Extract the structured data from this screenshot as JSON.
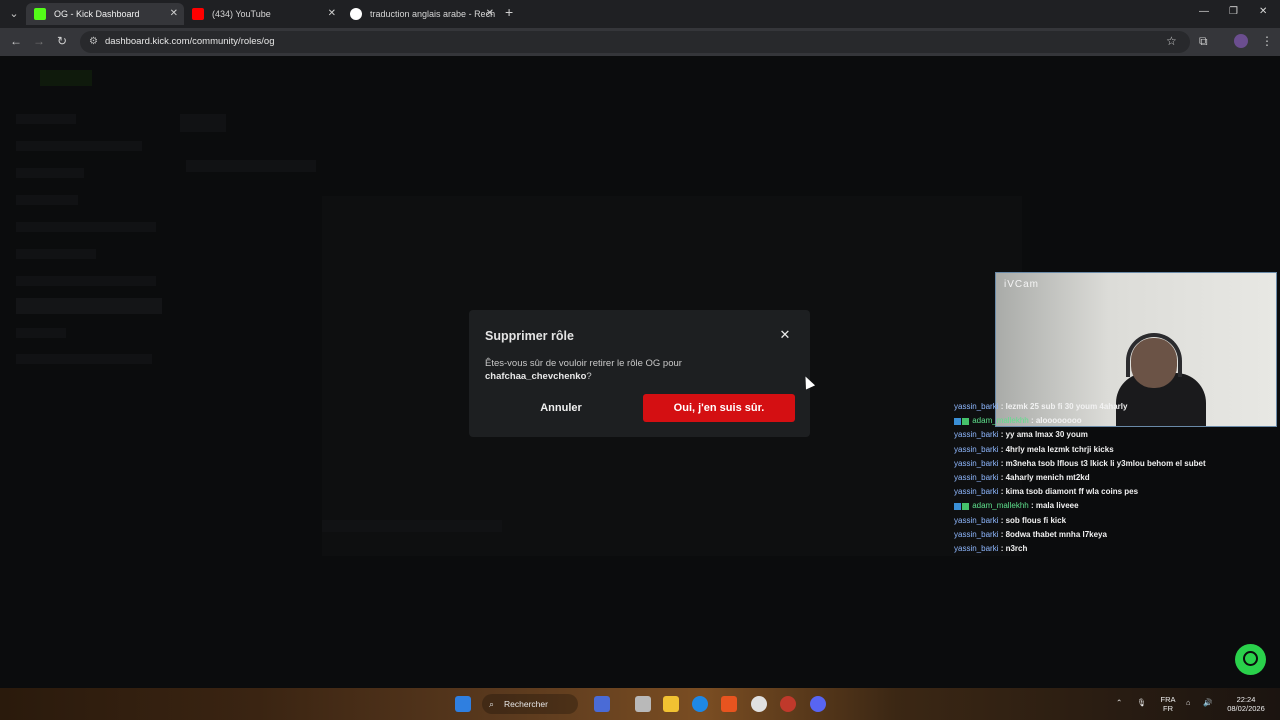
{
  "browser": {
    "tabs": [
      {
        "title": "OG - Kick Dashboard",
        "active": true,
        "favicon_color": "#53fc18"
      },
      {
        "title": "(434) YouTube",
        "active": false,
        "favicon_color": "#ff0000"
      },
      {
        "title": "traduction anglais arabe - Rech",
        "active": false,
        "favicon_color": "#4285f4"
      }
    ],
    "url": "dashboard.kick.com/community/roles/og"
  },
  "modal": {
    "title": "Supprimer rôle",
    "message_prefix": "Êtes-vous sûr de vouloir retirer le rôle OG pour",
    "username": "chafchaa_chevchenko",
    "message_suffix": "?",
    "cancel_label": "Annuler",
    "confirm_label": "Oui, j'en suis sûr.",
    "confirm_color": "#d40f12"
  },
  "webcam": {
    "label": "iVCam"
  },
  "chat": [
    {
      "user": "yassin_barki",
      "text": ": lezmk 25 sub fi 30 youm 4aharly",
      "badge": false
    },
    {
      "user": "adam_mallekhh",
      "text": ": aloooooooo",
      "badge": true
    },
    {
      "user": "yassin_barki",
      "text": ": yy ama lmax 30 youm",
      "badge": false
    },
    {
      "user": "yassin_barki",
      "text": ": 4hrly mela lezmk tchrji kicks",
      "badge": false
    },
    {
      "user": "yassin_barki",
      "text": ": m3neha tsob lflous t3 lkick li y3mlou behom el subet",
      "badge": false
    },
    {
      "user": "yassin_barki",
      "text": ": 4aharly menich mt2kd",
      "badge": false
    },
    {
      "user": "yassin_barki",
      "text": ": kima tsob diamont ff wla coins pes",
      "badge": false
    },
    {
      "user": "adam_mallekhh",
      "text": ": mala liveee",
      "badge": true
    },
    {
      "user": "yassin_barki",
      "text": ": sob flous fi kick",
      "badge": false
    },
    {
      "user": "yassin_barki",
      "text": ": 8odwa thabet mnha l7keya",
      "badge": false
    },
    {
      "user": "yassin_barki",
      "text": ": n3rch",
      "badge": false
    }
  ],
  "taskbar": {
    "search_placeholder": "Rechercher",
    "language_top": "FRA",
    "language_bottom": "FR",
    "time": "22:24",
    "date": "08/02/2026"
  },
  "colors": {
    "accent": "#53fc18",
    "chat_user": "#8fb8ff",
    "chat_user_alt": "#5ee08c"
  }
}
